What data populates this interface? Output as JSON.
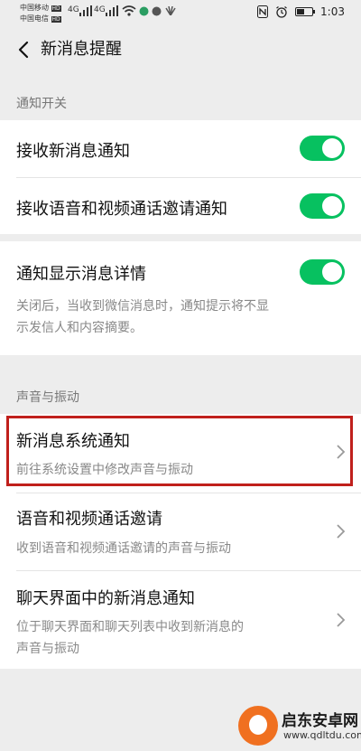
{
  "status_bar": {
    "carrier_1": "中国移动",
    "carrier_2": "中国电信",
    "hd": "HD",
    "net_1": "4G",
    "net_2": "4G",
    "time": "1:03",
    "battery_level": 0.45,
    "icons": [
      "signal-icon",
      "wifi-icon",
      "nfc-icon",
      "alarm-icon",
      "battery-icon"
    ]
  },
  "nav": {
    "title": "新消息提醒",
    "back_icon": "chevron-left-icon"
  },
  "sections": {
    "notification_switch": {
      "title": "通知开关",
      "items": [
        {
          "label": "接收新消息通知",
          "on": true
        },
        {
          "label": "接收语音和视频通话邀请通知",
          "on": true
        }
      ]
    },
    "detail": {
      "label": "通知显示消息详情",
      "on": true,
      "desc_line1": "关闭后，当收到微信消息时，通知提示将不显",
      "desc_line2": "示发信人和内容摘要。"
    },
    "sound": {
      "title": "声音与振动",
      "items": [
        {
          "label": "新消息系统通知",
          "desc": "前往系统设置中修改声音与振动",
          "highlighted": true
        },
        {
          "label": "语音和视频通话邀请",
          "desc": "收到语音和视频通话邀请的声音与振动"
        },
        {
          "label": "聊天界面中的新消息通知",
          "desc_line1": "位于聊天界面和聊天列表中收到新消息的",
          "desc_line2": "声音与振动"
        }
      ]
    }
  },
  "colors": {
    "accent": "#07c160",
    "highlight": "#c0201c",
    "background": "#ededed"
  },
  "watermark": {
    "name": "启东安卓网",
    "url": "www.qdltdu.com"
  }
}
